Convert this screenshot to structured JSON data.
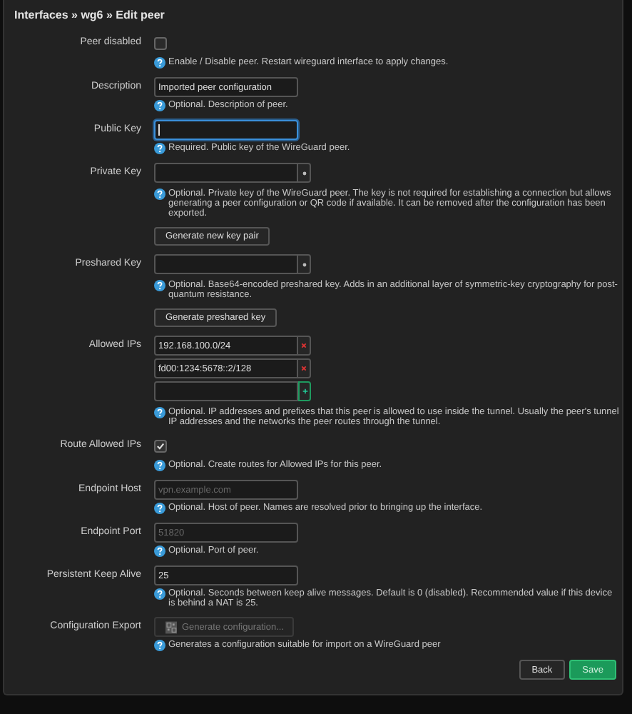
{
  "title": "Interfaces » wg6 » Edit peer",
  "rows": [
    {
      "kind": "checkbox",
      "label": "Peer disabled",
      "checked": false,
      "help": "Enable / Disable peer. Restart wireguard interface to apply changes."
    },
    {
      "kind": "text",
      "label": "Description",
      "value": "Imported peer configuration",
      "help": "Optional. Description of peer."
    },
    {
      "kind": "text",
      "label": "Public Key",
      "focused": true,
      "help": "Required. Public key of the WireGuard peer."
    },
    {
      "kind": "password",
      "label": "Private Key",
      "help": "Optional. Private key of the WireGuard peer. The key is not required for establishing a connection but allows generating a peer configuration or QR code if available. It can be removed after the configuration has been exported.",
      "button": "Generate new key pair"
    },
    {
      "kind": "password",
      "label": "Preshared Key",
      "help": "Optional. Base64-encoded preshared key. Adds in an additional layer of symmetric-key cryptography for post-quantum resistance.",
      "button": "Generate preshared key"
    },
    {
      "kind": "list",
      "label": "Allowed IPs",
      "items": [
        "192.168.100.0/24",
        "fd00:1234:5678::2/128"
      ],
      "help": "Optional. IP addresses and prefixes that this peer is allowed to use inside the tunnel. Usually the peer's tunnel IP addresses and the networks the peer routes through the tunnel."
    },
    {
      "kind": "checkbox",
      "label": "Route Allowed IPs",
      "checked": true,
      "help": "Optional. Create routes for Allowed IPs for this peer."
    },
    {
      "kind": "text",
      "label": "Endpoint Host",
      "placeholder": "vpn.example.com",
      "help": "Optional. Host of peer. Names are resolved prior to bringing up the interface."
    },
    {
      "kind": "text",
      "label": "Endpoint Port",
      "placeholder": "51820",
      "help": "Optional. Port of peer."
    },
    {
      "kind": "text",
      "label": "Persistent Keep Alive",
      "value": "25",
      "help": "Optional. Seconds between keep alive messages. Default is 0 (disabled). Recommended value if this device is behind a NAT is 25."
    },
    {
      "kind": "export",
      "label": "Configuration Export",
      "button": "Generate configuration...",
      "disabled": true,
      "help": "Generates a configuration suitable for import on a WireGuard peer"
    }
  ],
  "footer": [
    {
      "label": "Back",
      "kind": "default"
    },
    {
      "label": "Save",
      "kind": "primary"
    }
  ]
}
